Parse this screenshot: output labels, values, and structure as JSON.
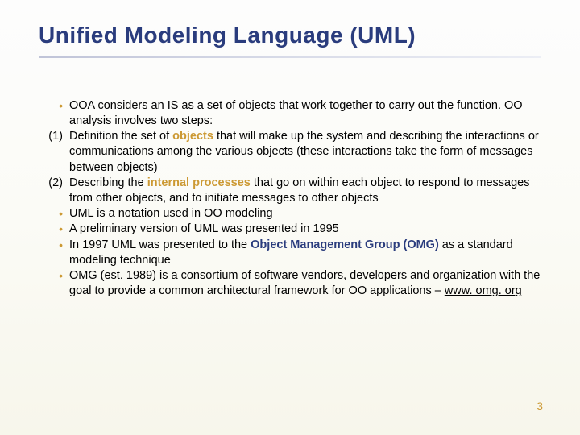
{
  "title": "Unified Modeling Language (UML)",
  "items": [
    {
      "marker": "•",
      "markerType": "bullet",
      "segments": [
        {
          "t": "OOA considers an IS as a set of objects that work together to carry out the function. OO analysis involves two steps:"
        }
      ]
    },
    {
      "marker": "(1)",
      "markerType": "num",
      "segments": [
        {
          "t": "Definition the set of "
        },
        {
          "t": "objects",
          "cls": "kw-objects"
        },
        {
          "t": " that will make up the system and describing the interactions or communications among the various objects (these interactions take the form of messages between objects)"
        }
      ]
    },
    {
      "marker": "(2)",
      "markerType": "num",
      "segments": [
        {
          "t": "Describing the "
        },
        {
          "t": "internal processes",
          "cls": "kw-internal"
        },
        {
          "t": " that go on within each object to respond to messages from other objects, and to initiate messages to other objects"
        }
      ]
    },
    {
      "marker": "•",
      "markerType": "bullet",
      "segments": [
        {
          "t": "UML is a notation used in OO modeling"
        }
      ]
    },
    {
      "marker": "•",
      "markerType": "bullet",
      "segments": [
        {
          "t": "A preliminary version of UML was presented in 1995"
        }
      ]
    },
    {
      "marker": "•",
      "markerType": "bullet",
      "segments": [
        {
          "t": "In 1997 UML was presented to the "
        },
        {
          "t": "Object Management Group (OMG)",
          "cls": "kw-omg"
        },
        {
          "t": " as a standard modeling technique"
        }
      ]
    },
    {
      "marker": "•",
      "markerType": "bullet",
      "segments": [
        {
          "t": "OMG (est. 1989) is a consortium of software vendors, developers and organization with the goal to provide a common architectural framework for OO applications – "
        },
        {
          "t": "www. omg. org",
          "cls": "link"
        }
      ]
    }
  ],
  "page_number": "3"
}
